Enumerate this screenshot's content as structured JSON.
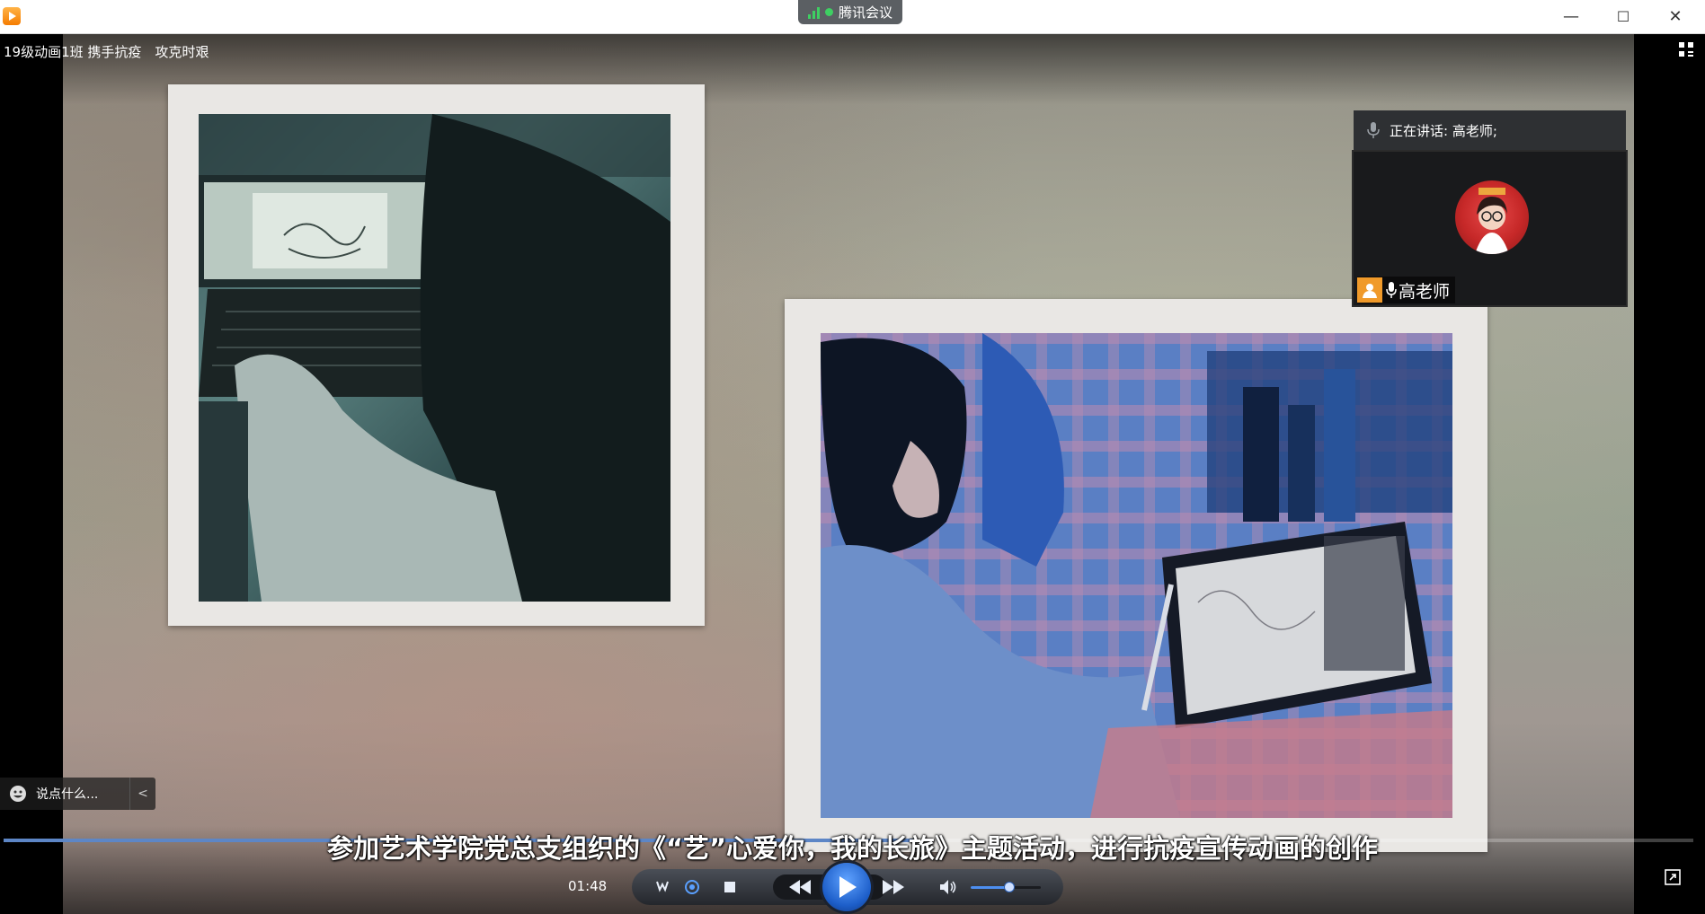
{
  "window": {
    "meeting_app_label": "腾讯会议",
    "minimize_label": "—",
    "maximize_label": "☐",
    "close_label": "✕"
  },
  "meeting": {
    "title": "19级动画1班 携手抗疫　攻克时艰"
  },
  "camera": {
    "speaking_label": "正在讲话: 高老师;",
    "participant_name": "高老师"
  },
  "danmaku": {
    "placeholder": "说点什么...",
    "collapse_label": "<"
  },
  "player": {
    "subtitle": "参加艺术学院党总支组织的《“艺”心爱你，我的长旅》主题活动，进行抗疫宣传动画的创作",
    "time": "01:48",
    "progress": 0.54,
    "volume": 0.55
  },
  "colors": {
    "accent": "#1d5ec9",
    "meeting_green": "#3ecf62",
    "name_tag_orange": "#f09a2a"
  },
  "icons": [
    "app-logo-icon",
    "signal-icon",
    "record-dot-icon",
    "grid-view-icon",
    "microphone-icon",
    "person-icon",
    "emoji-icon",
    "loop-icon",
    "refresh-icon",
    "stop-icon",
    "rewind-icon",
    "play-icon",
    "fast-forward-icon",
    "volume-icon",
    "fullscreen-icon"
  ]
}
